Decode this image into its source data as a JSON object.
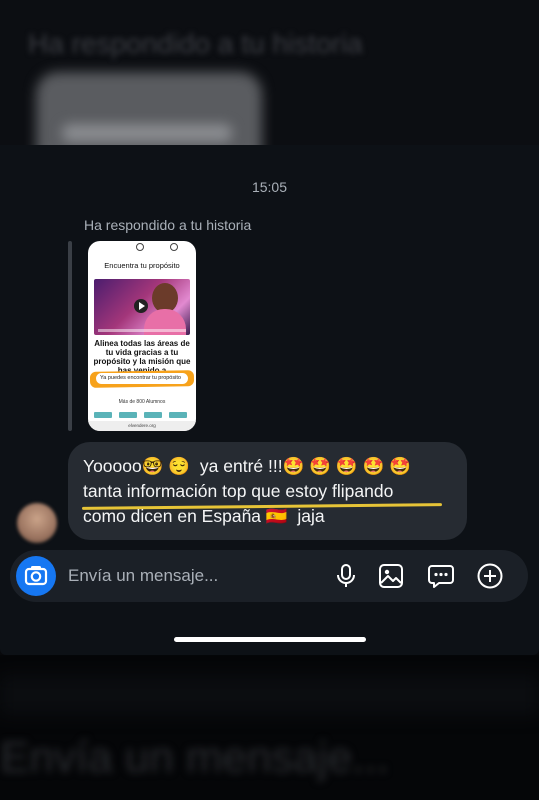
{
  "conversation": {
    "timestamp": "15:05",
    "story_reply_label": "Ha respondido a tu historia",
    "story_preview": {
      "title": "Encuentra tu propósito",
      "headline": "Alinea todas las áreas de tu vida gracias a tu propósito y la misión que has venido a",
      "pill_text": "Ya puedes encontrar tu propósito",
      "stat_text": "Más de 800 Alumnos",
      "footer_url": "elvendere.org"
    },
    "message": {
      "line1": "Yooooo🤓 😌  ya entré !!!🤩 🤩 🤩 🤩 🤩",
      "line2": "tanta información top que estoy flipando",
      "line3": "como dicen en España 🇪🇸  jaja"
    }
  },
  "composer": {
    "placeholder": "Envía un mensaje..."
  },
  "background": {
    "top_text": "Ha respondido a tu historia",
    "bottom_text": "Envía un mensaje..."
  },
  "colors": {
    "panel": "#0d1116",
    "bubble": "#262b32",
    "accent_blue": "#1677f2",
    "underline": "#e6c437"
  },
  "icons": {
    "camera": "camera-icon",
    "microphone": "microphone-icon",
    "gallery": "gallery-icon",
    "sticker": "sticker-chat-icon",
    "add": "plus-circle-icon"
  }
}
